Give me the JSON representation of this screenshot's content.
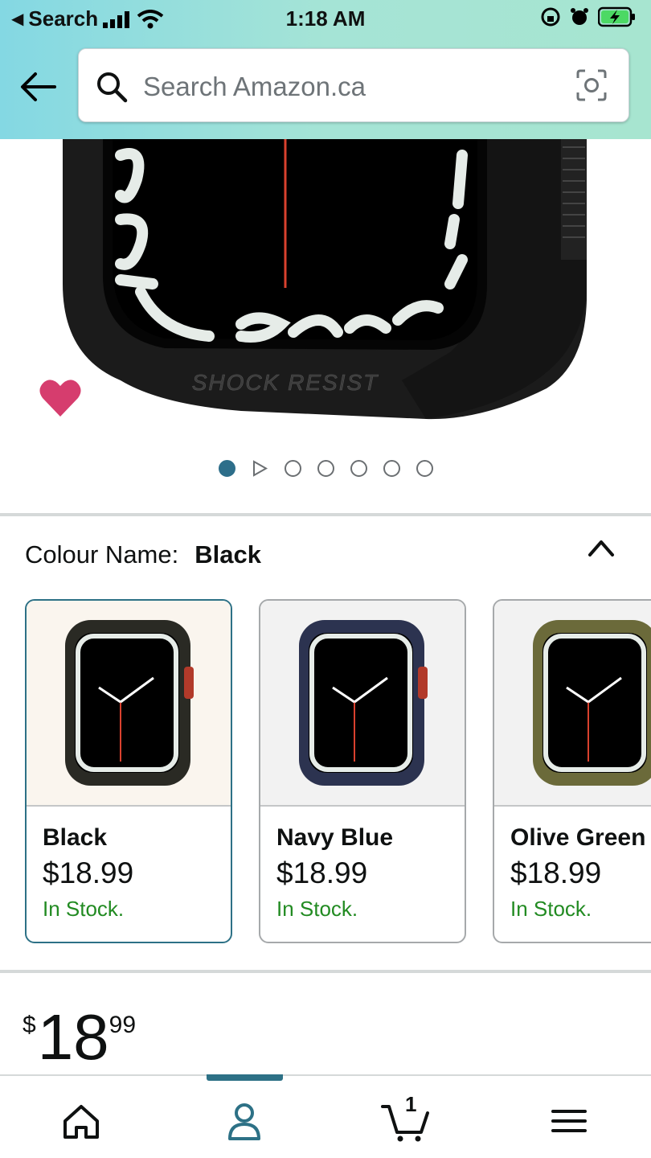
{
  "status_bar": {
    "back_label": "Search",
    "time": "1:18 AM"
  },
  "search": {
    "placeholder": "Search Amazon.ca"
  },
  "product_image": {
    "case_text": "SHOCK RESIST"
  },
  "carousel": {
    "total_dots": 7,
    "active_index": 0
  },
  "colour": {
    "label": "Colour Name:",
    "selected": "Black",
    "options": [
      {
        "name": "Black",
        "price": "$18.99",
        "stock": "In Stock.",
        "case_color": "#2a2a24",
        "bg": "#faf5ee"
      },
      {
        "name": "Navy Blue",
        "price": "$18.99",
        "stock": "In Stock.",
        "case_color": "#2c3350",
        "bg": "#f2f2f2"
      },
      {
        "name": "Olive Green",
        "price": "$18.99",
        "stock": "In Stock.",
        "case_color": "#6b6a3a",
        "bg": "#f2f2f2"
      }
    ]
  },
  "price": {
    "symbol": "$",
    "whole": "18",
    "fraction": "99"
  },
  "cart": {
    "count": "1"
  },
  "colors": {
    "accent": "#2d7186",
    "stock_green": "#228b22",
    "heart": "#d63d6e"
  }
}
